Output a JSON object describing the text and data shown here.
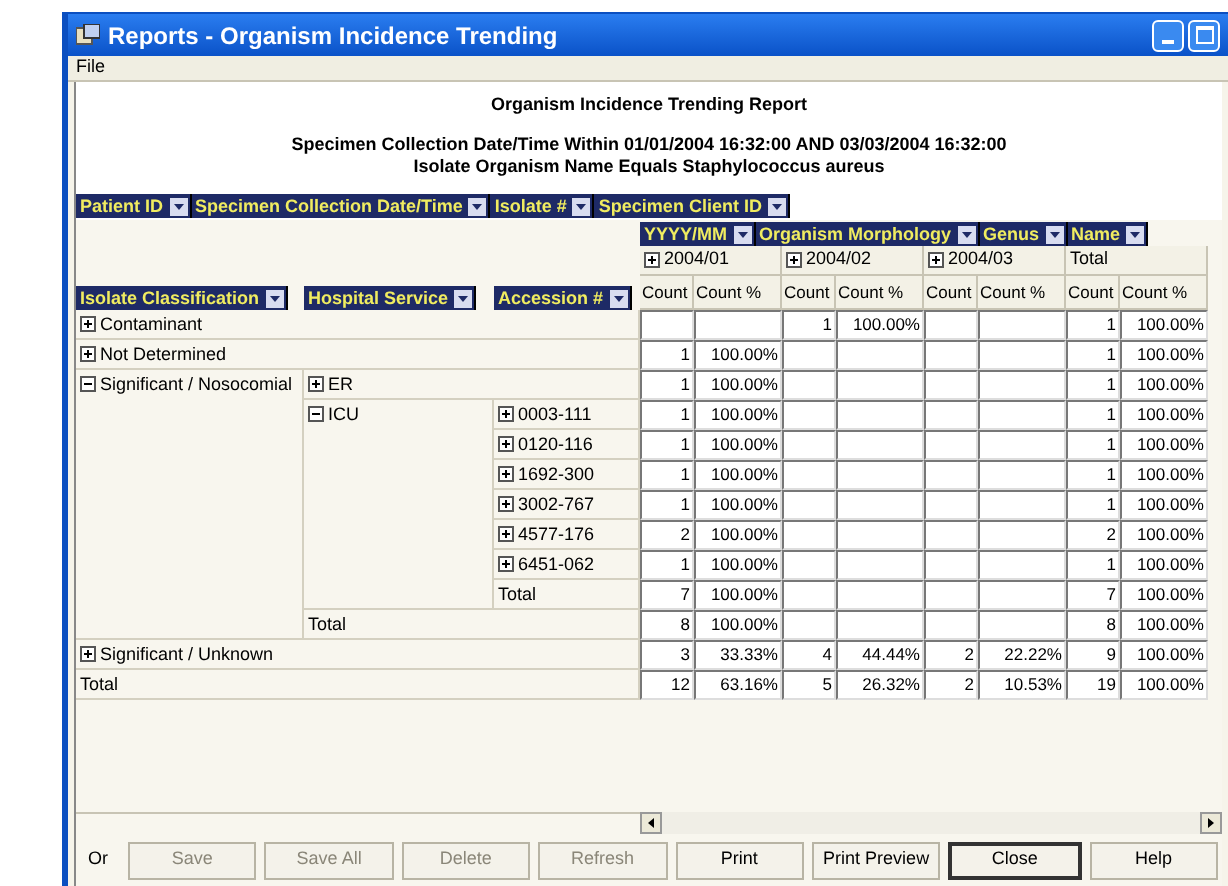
{
  "window": {
    "title": "Reports - Organism Incidence Trending"
  },
  "menu": [
    "File"
  ],
  "report": {
    "title": "Organism Incidence Trending Report",
    "criteria": [
      "Specimen Collection Date/Time  Within 01/01/2004 16:32:00 AND 03/03/2004 16:32:00",
      "Isolate Organism Name  Equals Staphylococcus aureus"
    ]
  },
  "page_fields": [
    "Patient ID",
    "Specimen Collection Date/Time",
    "Isolate #",
    "Specimen Client ID"
  ],
  "column_fields": [
    "YYYY/MM",
    "Organism Morphology",
    "Genus",
    "Name"
  ],
  "row_fields": [
    "Isolate Classification",
    "Hospital Service",
    "Accession #"
  ],
  "columns": [
    {
      "label": "2004/01",
      "expanded": false,
      "measures": [
        "Count",
        "Count %"
      ]
    },
    {
      "label": "2004/02",
      "expanded": false,
      "measures": [
        "Count",
        "Count %"
      ]
    },
    {
      "label": "2004/03",
      "expanded": false,
      "measures": [
        "Count",
        "Count %"
      ]
    },
    {
      "label": "Total",
      "kind": "total",
      "measures": [
        "Count",
        "Count %"
      ]
    }
  ],
  "rows": [
    {
      "label": "Contaminant",
      "expanded": false,
      "values": {
        "col_2": {
          "count": "1",
          "percent": "100.00%"
        },
        "col_4": {
          "count": "1",
          "percent": "100.00%"
        }
      }
    },
    {
      "label": "Not Determined",
      "expanded": false,
      "values": {
        "col_1": {
          "count": "1",
          "percent": "100.00%"
        },
        "col_4": {
          "count": "1",
          "percent": "100.00%"
        }
      }
    },
    {
      "label": "Significant / Nosocomial",
      "expanded": true,
      "children": [
        {
          "label": "ER",
          "expanded": false,
          "values": {
            "col_1": {
              "count": "1",
              "percent": "100.00%"
            },
            "col_4": {
              "count": "1",
              "percent": "100.00%"
            }
          }
        },
        {
          "label": "ICU",
          "expanded": true,
          "children": [
            {
              "label": "0003-111",
              "expanded": false,
              "values": {
                "col_1": {
                  "count": "1",
                  "percent": "100.00%"
                },
                "col_4": {
                  "count": "1",
                  "percent": "100.00%"
                }
              }
            },
            {
              "label": "0120-116",
              "expanded": false,
              "values": {
                "col_1": {
                  "count": "1",
                  "percent": "100.00%"
                },
                "col_4": {
                  "count": "1",
                  "percent": "100.00%"
                }
              }
            },
            {
              "label": "1692-300",
              "expanded": false,
              "values": {
                "col_1": {
                  "count": "1",
                  "percent": "100.00%"
                },
                "col_4": {
                  "count": "1",
                  "percent": "100.00%"
                }
              }
            },
            {
              "label": "3002-767",
              "expanded": false,
              "values": {
                "col_1": {
                  "count": "1",
                  "percent": "100.00%"
                },
                "col_4": {
                  "count": "1",
                  "percent": "100.00%"
                }
              }
            },
            {
              "label": "4577-176",
              "expanded": false,
              "values": {
                "col_1": {
                  "count": "2",
                  "percent": "100.00%"
                },
                "col_4": {
                  "count": "2",
                  "percent": "100.00%"
                }
              }
            },
            {
              "label": "6451-062",
              "expanded": false,
              "values": {
                "col_1": {
                  "count": "1",
                  "percent": "100.00%"
                },
                "col_4": {
                  "count": "1",
                  "percent": "100.00%"
                }
              }
            },
            {
              "label": "Total",
              "kind": "total",
              "values": {
                "col_1": {
                  "count": "7",
                  "percent": "100.00%"
                },
                "col_4": {
                  "count": "7",
                  "percent": "100.00%"
                }
              }
            }
          ]
        },
        {
          "label": "Total",
          "kind": "total",
          "values": {
            "col_1": {
              "count": "8",
              "percent": "100.00%"
            },
            "col_4": {
              "count": "8",
              "percent": "100.00%"
            }
          }
        }
      ]
    },
    {
      "label": "Significant / Unknown",
      "expanded": false,
      "values": {
        "col_1": {
          "count": "3",
          "percent": "33.33%"
        },
        "col_2": {
          "count": "4",
          "percent": "44.44%"
        },
        "col_3": {
          "count": "2",
          "percent": "22.22%"
        },
        "col_4": {
          "count": "9",
          "percent": "100.00%"
        }
      }
    },
    {
      "label": "Total",
      "kind": "total",
      "values": {
        "col_1": {
          "count": "12",
          "percent": "63.16%"
        },
        "col_2": {
          "count": "5",
          "percent": "26.32%"
        },
        "col_3": {
          "count": "2",
          "percent": "10.53%"
        },
        "col_4": {
          "count": "19",
          "percent": "100.00%"
        }
      }
    }
  ],
  "footer_label": "Or",
  "buttons": [
    {
      "label": "Save",
      "disabled": true,
      "default": false
    },
    {
      "label": "Save All",
      "disabled": true,
      "default": false
    },
    {
      "label": "Delete",
      "disabled": true,
      "default": false
    },
    {
      "label": "Refresh",
      "disabled": true,
      "default": false
    },
    {
      "label": "Print",
      "disabled": false,
      "default": false
    },
    {
      "label": "Print Preview",
      "disabled": false,
      "default": false
    },
    {
      "label": "Close",
      "disabled": false,
      "default": true
    },
    {
      "label": "Help",
      "disabled": false,
      "default": false
    }
  ]
}
